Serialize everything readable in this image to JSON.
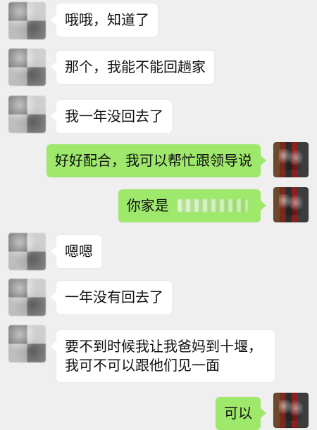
{
  "messages": [
    {
      "side": "left",
      "text": "哦哦，知道了"
    },
    {
      "side": "left",
      "text": "那个，我能不能回趟家"
    },
    {
      "side": "left",
      "text": "我一年没回去了"
    },
    {
      "side": "right",
      "text": "好好配合，我可以帮忙跟领导说"
    },
    {
      "side": "right",
      "text": "你家是"
    },
    {
      "side": "left",
      "text": "嗯嗯"
    },
    {
      "side": "left",
      "text": "一年没有回去了"
    },
    {
      "side": "left",
      "text": "要不到时候我让我爸妈到十堰，我可不可以跟他们见一面"
    },
    {
      "side": "right",
      "text": "可以"
    }
  ]
}
